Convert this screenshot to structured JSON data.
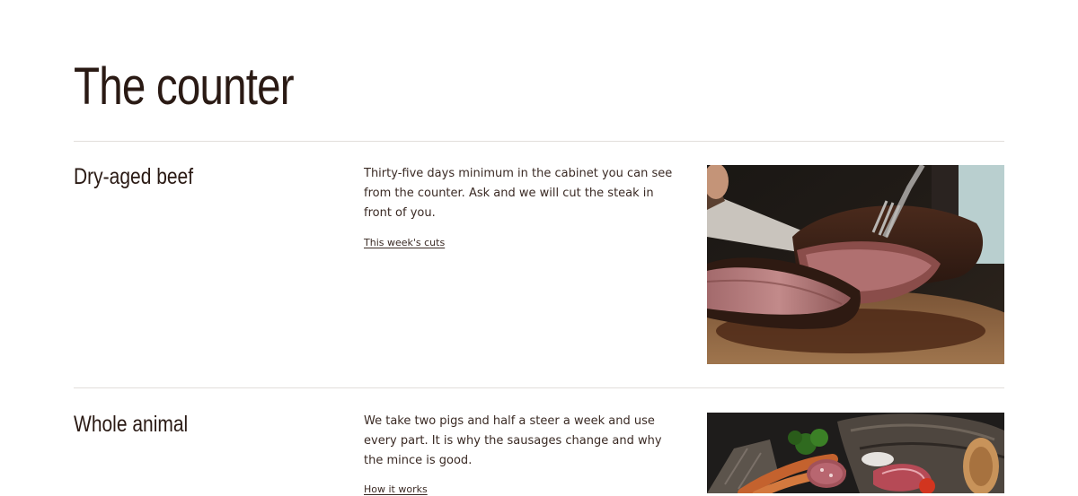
{
  "page": {
    "title": "The counter"
  },
  "sections": [
    {
      "heading": "Dry-aged beef",
      "body": "Thirty-five days minimum in the cabinet you can see from the counter. Ask and we will cut the steak in front of you.",
      "link": "This week's cuts",
      "image_icon": "steak-photo"
    },
    {
      "heading": "Whole animal",
      "body": "We take two pigs and half a steer a week and use every part. It is why the sausages change and why the mince is good.",
      "link": "How it works",
      "image_icon": "charcuterie-photo"
    }
  ],
  "colors": {
    "text": "#2a1a14",
    "divider": "#e2dedb",
    "background": "#ffffff"
  }
}
